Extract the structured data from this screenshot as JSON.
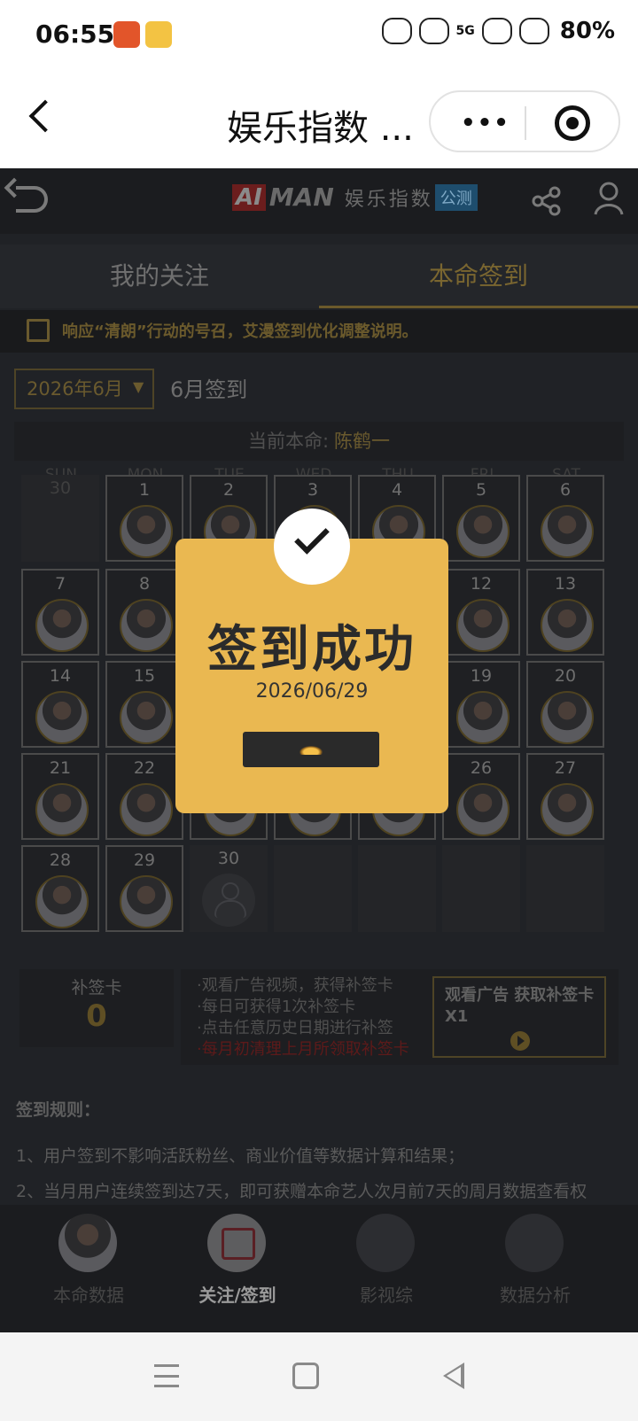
{
  "status_bar": {
    "time": "06:55",
    "network": "5G",
    "battery": "80%"
  },
  "top_bar": {
    "title": "娱乐指数 ...",
    "more_dots": "•••"
  },
  "app_header": {
    "logo_ai": "AI",
    "logo_man": "MAN",
    "logo_text": "娱乐指数",
    "logo_badge": "公测"
  },
  "tabs": [
    {
      "label": "我的关注"
    },
    {
      "label": "本命签到"
    }
  ],
  "notice": {
    "text": "响应“清朗”行动的号召，艾漫签到优化调整说明。"
  },
  "calendar": {
    "month_select": "2026年6月",
    "month_label": "6月签到",
    "current_label": "当前本命:",
    "current_name": "陈鹤一",
    "weekdays": [
      "SUN",
      "MON",
      "TUE",
      "WED",
      "THU",
      "FRI",
      "SAT"
    ]
  },
  "supplement": {
    "card_title": "补签卡",
    "card_count": "0",
    "tips": [
      "·观看广告视频，获得补签卡",
      "·每日可获得1次补签卡",
      "·点击任意历史日期进行补签",
      "·每月初清理上月所领取补签卡"
    ],
    "ad_button": "观看广告 获取补签卡X1"
  },
  "rules": {
    "title": "签到规则：",
    "items": [
      "1、用户签到不影响活跃粉丝、商业价值等数据计算和结果；",
      "2、当月用户连续签到达7天，即可获赠本命艺人次月前7天的周月数据查看权"
    ]
  },
  "bottom_nav": [
    {
      "label": "本命数据"
    },
    {
      "label": "关注/签到"
    },
    {
      "label": "影视综"
    },
    {
      "label": "数据分析"
    }
  ],
  "modal": {
    "title": "签到成功",
    "date": "2026/06/29"
  },
  "colors": {
    "modal_bg": "#eab851",
    "accent_gold": "#c9a04a"
  }
}
